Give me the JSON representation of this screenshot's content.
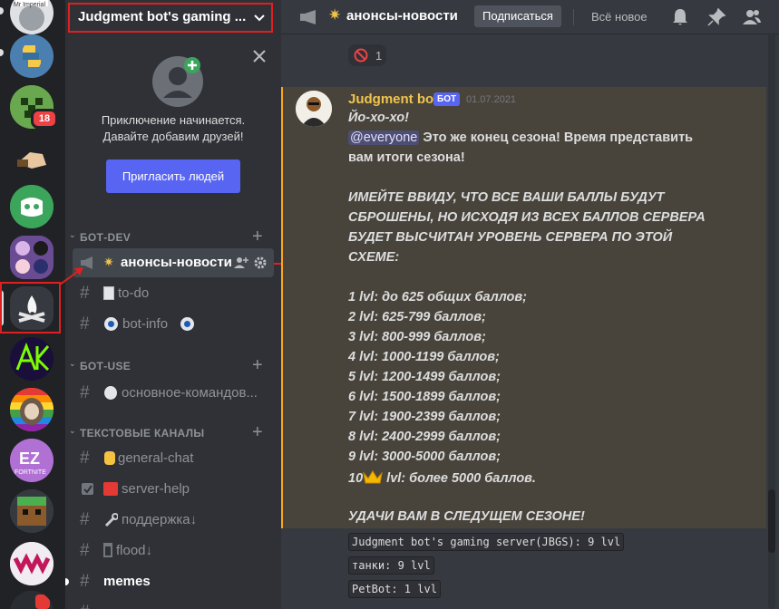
{
  "rail": {
    "servers": [
      {
        "name": "server-mr-imperial",
        "label": "Mr Imperial",
        "color": "#dfe1e5"
      },
      {
        "name": "server-python",
        "color": "#2c5d8f"
      },
      {
        "name": "server-minecraft-creeper",
        "color": "#5b8c3a",
        "badge": "18"
      },
      {
        "name": "server-hand",
        "color": "#202225"
      },
      {
        "name": "server-green-clyde",
        "color": "#3ba55c"
      },
      {
        "name": "server-purple-group",
        "color": "#7e59a8"
      },
      {
        "name": "server-judgment-bot-campfire",
        "color": "#36393f"
      },
      {
        "name": "server-neon-ak",
        "color": "#2a1654"
      },
      {
        "name": "server-sloth-rainbow",
        "color": "#e8b23a"
      },
      {
        "name": "server-ez-fortnite",
        "color": "#a35fc8",
        "label": "FORTNITE"
      },
      {
        "name": "server-minecraft-block",
        "color": "#2c6b23"
      },
      {
        "name": "server-shark-teeth",
        "color": "#e6e3e8"
      },
      {
        "name": "server-bottom",
        "color": "#3b3f46"
      }
    ]
  },
  "guild": {
    "name": "Judgment bot's gaming ...",
    "invite_line1": "Приключение начинается.",
    "invite_line2": "Давайте добавим друзей!",
    "invite_button": "Пригласить людей"
  },
  "categories": {
    "bot_dev": "БОТ-DEV",
    "bot_use": "БОТ-USE",
    "text_channels": "ТЕКСТОВЫЕ КАНАЛЫ"
  },
  "channels": {
    "announce": "анонсы-новости",
    "todo": "to-do",
    "bot_info": "bot-info",
    "commands": "основное-командов...",
    "general": "general-chat",
    "server_help": "server-help",
    "support": "поддержка↓",
    "flood": "flood↓",
    "memes": "memes"
  },
  "topbar": {
    "channel": "анонсы-новости",
    "subscribe": "Подписаться",
    "all_new": "Всё новое"
  },
  "reaction": {
    "count": "1"
  },
  "message": {
    "author": "Judgment bot",
    "tag": "БОТ",
    "timestamp": "01.07.2021",
    "mention": "@everyone",
    "lines": {
      "l0": "Йо-хо-хо!",
      "l1b": " Это же конец сезона! Время представить",
      "l2": "вам итоги сезона!",
      "l3": "ИМЕЙТЕ ВВИДУ, ЧТО ВСЕ ВАШИ БАЛЛЫ БУДУТ",
      "l4": "СБРОШЕНЫ, НО ИСХОДЯ ИЗ ВСЕХ БАЛЛОВ СЕРВЕРА",
      "l5": "БУДЕТ ВЫСЧИТАН УРОВЕНЬ СЕРВЕРА ПО ЭТОЙ",
      "l6": "СХЕМЕ:",
      "lvl1": "1 lvl: до 625 общих баллов;",
      "lvl2": "2 lvl: 625-799 баллов;",
      "lvl3": "3 lvl: 800-999 баллов;",
      "lvl4": "4 lvl: 1000-1199 баллов;",
      "lvl5": "5 lvl: 1200-1499 баллов;",
      "lvl6": "6 lvl: 1500-1899 баллов;",
      "lvl7": "7 lvl: 1900-2399 баллов;",
      "lvl8": "8 lvl: 2400-2999 баллов;",
      "lvl9": "9 lvl: 3000-5000 баллов;",
      "lvl10a": "10",
      "lvl10b": " lvl: более 5000 баллов.",
      "luck": "УДАЧИ ВАМ В СЛЕДУЩЕМ СЕЗОНЕ!"
    }
  },
  "results": [
    "Judgment bot's gaming server(JBGS): 9 lvl",
    "танки: 9 lvl",
    "PetBot: 1 lvl"
  ],
  "colors": {
    "accent": "#5865f2",
    "highlight_red": "#e02020",
    "mention_border": "#faa81a",
    "author": "#f0c44c"
  }
}
